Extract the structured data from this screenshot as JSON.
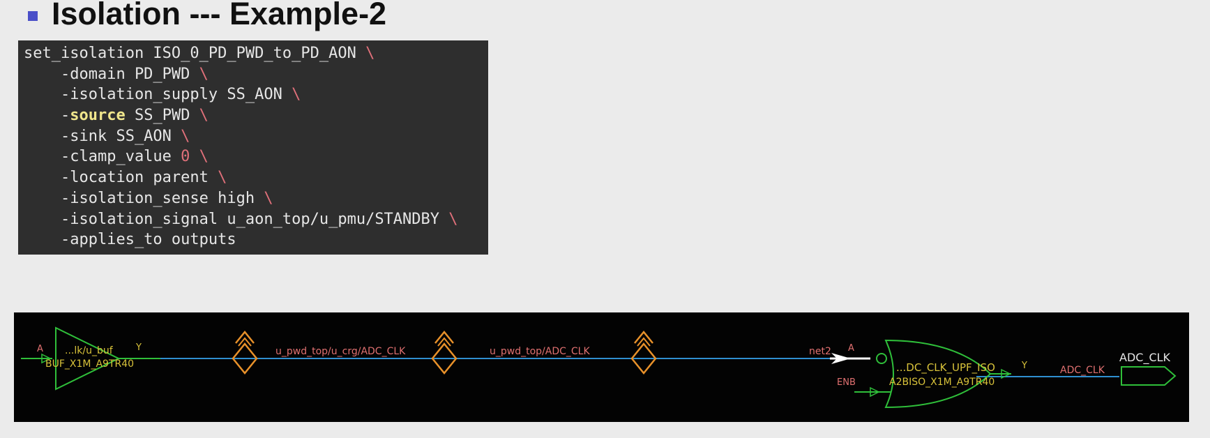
{
  "slide": {
    "title": "Isolation --- Example-2"
  },
  "code": {
    "line1_cmd": "set_isolation ISO_0_PD_PWD_to_PD_AON",
    "line2_opt": "    -domain PD_PWD",
    "line3_opt": "    -isolation_supply SS_AON",
    "line4_dash": "    -",
    "line4_kw": "source",
    "line4_rest": " SS_PWD",
    "line5_opt": "    -sink SS_AON",
    "line6_opt": "    -clamp_value ",
    "line6_val": "0",
    "line7_opt": "    -location parent",
    "line8_opt": "    -isolation_sense high",
    "line9_opt": "    -isolation_signal u_aon_top/u_pmu/STANDBY",
    "line10_opt": "    -applies_to outputs",
    "continuation": " \\"
  },
  "schematic": {
    "buffer": {
      "pin_in": "A",
      "pin_out": "Y",
      "inst_name": "...lk/u_buf",
      "cell_name": "BUF_X1M_A9TR40"
    },
    "net1": "u_pwd_top/u_crg/ADC_CLK",
    "net2_label": "u_pwd_top/ADC_CLK",
    "net3": "net2",
    "iso_cell": {
      "pin_a": "A",
      "pin_enb": "ENB",
      "pin_y": "Y",
      "inst_name": "...DC_CLK_UPF_ISO",
      "cell_name": "A2BISO_X1M_A9TR40"
    },
    "out_net": "ADC_CLK",
    "out_port": "ADC_CLK",
    "colors": {
      "wire": "#2f8fd0",
      "gate": "#2fbf3a",
      "net_label": "#e07070",
      "cell_label": "#d8c23a",
      "boundary": "#e8912a"
    }
  }
}
